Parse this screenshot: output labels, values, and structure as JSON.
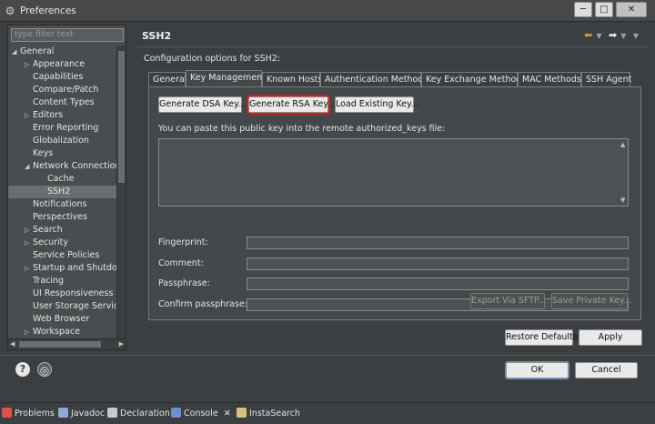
{
  "window": {
    "title": "Preferences",
    "minimize": "─",
    "maximize": "□",
    "close": "✕"
  },
  "filter": {
    "placeholder": "type filter text"
  },
  "tree": [
    {
      "label": "General",
      "level": 0,
      "twisty": "expanded"
    },
    {
      "label": "Appearance",
      "level": 1,
      "twisty": "collapsed"
    },
    {
      "label": "Capabilities",
      "level": 1,
      "twisty": ""
    },
    {
      "label": "Compare/Patch",
      "level": 1,
      "twisty": ""
    },
    {
      "label": "Content Types",
      "level": 1,
      "twisty": ""
    },
    {
      "label": "Editors",
      "level": 1,
      "twisty": "collapsed"
    },
    {
      "label": "Error Reporting",
      "level": 1,
      "twisty": ""
    },
    {
      "label": "Globalization",
      "level": 1,
      "twisty": ""
    },
    {
      "label": "Keys",
      "level": 1,
      "twisty": ""
    },
    {
      "label": "Network Connection",
      "level": 1,
      "twisty": "expanded"
    },
    {
      "label": "Cache",
      "level": 2,
      "twisty": ""
    },
    {
      "label": "SSH2",
      "level": 2,
      "twisty": "",
      "selected": true
    },
    {
      "label": "Notifications",
      "level": 1,
      "twisty": ""
    },
    {
      "label": "Perspectives",
      "level": 1,
      "twisty": ""
    },
    {
      "label": "Search",
      "level": 1,
      "twisty": "collapsed"
    },
    {
      "label": "Security",
      "level": 1,
      "twisty": "collapsed"
    },
    {
      "label": "Service Policies",
      "level": 1,
      "twisty": ""
    },
    {
      "label": "Startup and Shutdown",
      "level": 1,
      "twisty": "collapsed"
    },
    {
      "label": "Tracing",
      "level": 1,
      "twisty": ""
    },
    {
      "label": "UI Responsiveness Monitoring",
      "level": 1,
      "twisty": ""
    },
    {
      "label": "User Storage Service",
      "level": 1,
      "twisty": ""
    },
    {
      "label": "Web Browser",
      "level": 1,
      "twisty": ""
    },
    {
      "label": "Workspace",
      "level": 1,
      "twisty": "collapsed"
    }
  ],
  "page": {
    "title": "SSH2",
    "description": "Configuration options for SSH2:"
  },
  "tabs": [
    "General",
    "Key Management",
    "Known Hosts",
    "Authentication Methods",
    "Key Exchange Methods",
    "MAC Methods",
    "SSH Agent"
  ],
  "active_tab": "Key Management",
  "key_mgmt": {
    "gen_dsa": "Generate DSA Key...",
    "gen_rsa": "Generate RSA Key...",
    "load_key": "Load Existing Key...",
    "paste_label": "You can paste this public key into the remote authorized_keys file:",
    "fingerprint": "Fingerprint:",
    "comment": "Comment:",
    "passphrase": "Passphrase:",
    "confirm_passphrase": "Confirm passphrase:",
    "export_sftp": "Export Via SFTP...",
    "save_private": "Save Private Key..."
  },
  "buttons": {
    "restore_defaults": "Restore Defaults",
    "apply": "Apply",
    "ok": "OK",
    "cancel": "Cancel"
  },
  "icons": {
    "help": "?",
    "import_export": "◎"
  },
  "view_tabs": [
    {
      "label": "Problems",
      "icon": "problems-icon",
      "color": "#d9534f"
    },
    {
      "label": "Javadoc",
      "icon": "javadoc-icon",
      "color": "#8fa9d6"
    },
    {
      "label": "Declaration",
      "icon": "declaration-icon",
      "color": "#c9c9c9"
    },
    {
      "label": "Console",
      "icon": "console-icon",
      "color": "#6d8fcf"
    },
    {
      "label": "InstaSearch",
      "icon": "instasearch-icon",
      "color": "#d8c27a"
    }
  ],
  "console_close": "✕"
}
